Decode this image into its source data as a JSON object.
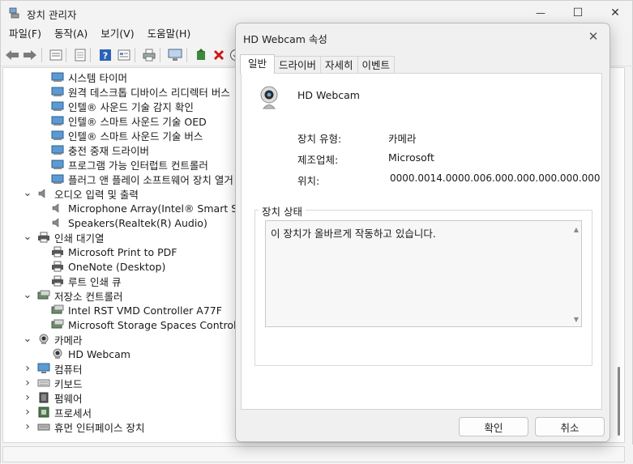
{
  "window": {
    "title": "장치 관리자",
    "controls": {
      "minimize": "—",
      "maximize": "☐",
      "close": "✕"
    }
  },
  "menu": [
    "파일(F)",
    "동작(A)",
    "보기(V)",
    "도움말(H)"
  ],
  "toolbar": [
    "back-icon",
    "forward-icon",
    "properties-icon",
    "update-icon",
    "help-icon",
    "view-icon",
    "print-icon",
    "scan-icon",
    "add-driver-icon",
    "remove-icon",
    "download-icon"
  ],
  "tree": {
    "items": [
      {
        "label": "시스템 타이머",
        "level": 2,
        "icon": "system"
      },
      {
        "label": "원격 데스크톱 디바이스 리디렉터 버스",
        "level": 2,
        "icon": "system"
      },
      {
        "label": "인텔® 사운드 기술 감지 확인",
        "level": 2,
        "icon": "system"
      },
      {
        "label": "인텔® 스마트 사운드 기술 OED",
        "level": 2,
        "icon": "system"
      },
      {
        "label": "인텔® 스마트 사운드 기술 버스",
        "level": 2,
        "icon": "system"
      },
      {
        "label": "충전 중재 드라이버",
        "level": 2,
        "icon": "system"
      },
      {
        "label": "프로그램 가능 인터럽트 컨트롤러",
        "level": 2,
        "icon": "system"
      },
      {
        "label": "플러그 앤 플레이 소프트웨어 장치 열거",
        "level": 2,
        "icon": "system"
      },
      {
        "label": "오디오 입력 및 출력",
        "level": 1,
        "icon": "audio",
        "expanded": true
      },
      {
        "label": "Microphone Array(Intel® Smart Sound",
        "level": 2,
        "icon": "audio"
      },
      {
        "label": "Speakers(Realtek(R) Audio)",
        "level": 2,
        "icon": "audio"
      },
      {
        "label": "인쇄 대기열",
        "level": 1,
        "icon": "printer",
        "expanded": true
      },
      {
        "label": "Microsoft Print to PDF",
        "level": 2,
        "icon": "printer"
      },
      {
        "label": "OneNote (Desktop)",
        "level": 2,
        "icon": "printer"
      },
      {
        "label": "루트 인쇄 큐",
        "level": 2,
        "icon": "printer"
      },
      {
        "label": "저장소 컨트롤러",
        "level": 1,
        "icon": "storage",
        "expanded": true
      },
      {
        "label": "Intel RST VMD Controller A77F",
        "level": 2,
        "icon": "storage"
      },
      {
        "label": "Microsoft Storage Spaces Controller",
        "level": 2,
        "icon": "storage"
      },
      {
        "label": "카메라",
        "level": 1,
        "icon": "camera",
        "expanded": true
      },
      {
        "label": "HD Webcam",
        "level": 2,
        "icon": "camera"
      },
      {
        "label": "컴퓨터",
        "level": 1,
        "icon": "computer",
        "expanded": false
      },
      {
        "label": "키보드",
        "level": 1,
        "icon": "keyboard",
        "expanded": false
      },
      {
        "label": "펌웨어",
        "level": 1,
        "icon": "firmware",
        "expanded": false
      },
      {
        "label": "프로세서",
        "level": 1,
        "icon": "processor",
        "expanded": false
      },
      {
        "label": "휴먼 인터페이스 장치",
        "level": 1,
        "icon": "hid",
        "expanded": false
      }
    ]
  },
  "dialog": {
    "title": "HD Webcam 속성",
    "tabs": [
      "일반",
      "드라이버",
      "자세히",
      "이벤트"
    ],
    "active_tab": "일반",
    "device_name": "HD Webcam",
    "properties": [
      {
        "label": "장치 유형:",
        "value": "카메라"
      },
      {
        "label": "제조업체:",
        "value": "Microsoft"
      },
      {
        "label": "위치:",
        "value": "0000.0014.0000.006.000.000.000.000.000"
      }
    ],
    "status_group_title": "장치 상태",
    "status_text": "이 장치가 올바르게 작동하고 있습니다.",
    "ok_label": "확인",
    "cancel_label": "취소",
    "close": "✕"
  }
}
